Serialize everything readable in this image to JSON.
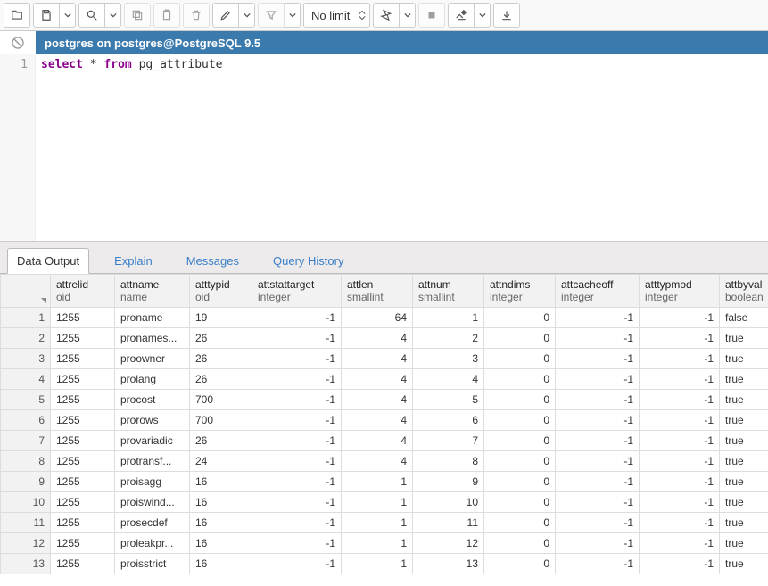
{
  "toolbar": {
    "limit_label": "No limit"
  },
  "connection": {
    "text": "postgres on postgres@PostgreSQL 9.5"
  },
  "editor": {
    "line_number": "1",
    "kw_select": "select",
    "star": "*",
    "kw_from": "from",
    "ident": "pg_attribute"
  },
  "tabs": {
    "data_output": "Data Output",
    "explain": "Explain",
    "messages": "Messages",
    "query_history": "Query History"
  },
  "columns": [
    {
      "name": "attrelid",
      "type": "oid",
      "align": "txt"
    },
    {
      "name": "attname",
      "type": "name",
      "align": "txt"
    },
    {
      "name": "atttypid",
      "type": "oid",
      "align": "txt"
    },
    {
      "name": "attstattarget",
      "type": "integer",
      "align": "num"
    },
    {
      "name": "attlen",
      "type": "smallint",
      "align": "num"
    },
    {
      "name": "attnum",
      "type": "smallint",
      "align": "num"
    },
    {
      "name": "attndims",
      "type": "integer",
      "align": "num"
    },
    {
      "name": "attcacheoff",
      "type": "integer",
      "align": "num"
    },
    {
      "name": "atttypmod",
      "type": "integer",
      "align": "num"
    },
    {
      "name": "attbyval",
      "type": "boolean",
      "align": "txt"
    }
  ],
  "rows": [
    {
      "n": 1,
      "cells": [
        "1255",
        "proname",
        "19",
        "-1",
        "64",
        "1",
        "0",
        "-1",
        "-1",
        "false"
      ]
    },
    {
      "n": 2,
      "cells": [
        "1255",
        "pronames...",
        "26",
        "-1",
        "4",
        "2",
        "0",
        "-1",
        "-1",
        "true"
      ]
    },
    {
      "n": 3,
      "cells": [
        "1255",
        "proowner",
        "26",
        "-1",
        "4",
        "3",
        "0",
        "-1",
        "-1",
        "true"
      ]
    },
    {
      "n": 4,
      "cells": [
        "1255",
        "prolang",
        "26",
        "-1",
        "4",
        "4",
        "0",
        "-1",
        "-1",
        "true"
      ]
    },
    {
      "n": 5,
      "cells": [
        "1255",
        "procost",
        "700",
        "-1",
        "4",
        "5",
        "0",
        "-1",
        "-1",
        "true"
      ]
    },
    {
      "n": 6,
      "cells": [
        "1255",
        "prorows",
        "700",
        "-1",
        "4",
        "6",
        "0",
        "-1",
        "-1",
        "true"
      ]
    },
    {
      "n": 7,
      "cells": [
        "1255",
        "provariadic",
        "26",
        "-1",
        "4",
        "7",
        "0",
        "-1",
        "-1",
        "true"
      ]
    },
    {
      "n": 8,
      "cells": [
        "1255",
        "protransf...",
        "24",
        "-1",
        "4",
        "8",
        "0",
        "-1",
        "-1",
        "true"
      ]
    },
    {
      "n": 9,
      "cells": [
        "1255",
        "proisagg",
        "16",
        "-1",
        "1",
        "9",
        "0",
        "-1",
        "-1",
        "true"
      ]
    },
    {
      "n": 10,
      "cells": [
        "1255",
        "proiswind...",
        "16",
        "-1",
        "1",
        "10",
        "0",
        "-1",
        "-1",
        "true"
      ]
    },
    {
      "n": 11,
      "cells": [
        "1255",
        "prosecdef",
        "16",
        "-1",
        "1",
        "11",
        "0",
        "-1",
        "-1",
        "true"
      ]
    },
    {
      "n": 12,
      "cells": [
        "1255",
        "proleakpr...",
        "16",
        "-1",
        "1",
        "12",
        "0",
        "-1",
        "-1",
        "true"
      ]
    },
    {
      "n": 13,
      "cells": [
        "1255",
        "proisstrict",
        "16",
        "-1",
        "1",
        "13",
        "0",
        "-1",
        "-1",
        "true"
      ]
    }
  ]
}
